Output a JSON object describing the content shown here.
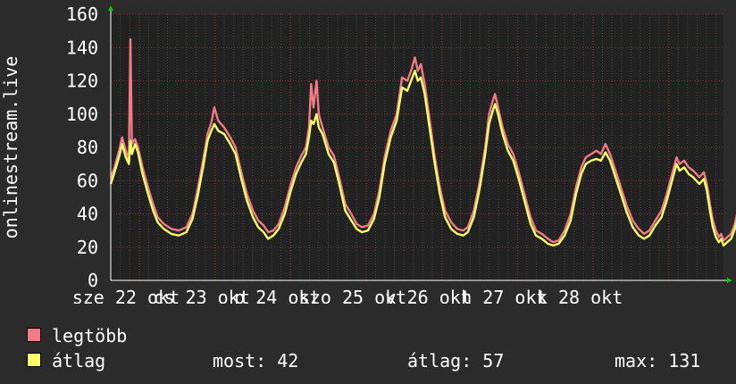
{
  "chart_data": {
    "type": "line",
    "ylabel": "onlinestream.live",
    "ylim": [
      0,
      160
    ],
    "yticks": [
      0,
      20,
      40,
      60,
      80,
      100,
      120,
      140,
      160
    ],
    "xlim": [
      0,
      8.1
    ],
    "grid": true,
    "colors": {
      "background": "#2b2b2b",
      "plot_background": "#222222",
      "grid": "#4a4a4a",
      "max_series": "#f07a85",
      "avg_series": "#ffff66",
      "axis": "#ffffff",
      "arrow": "#00cc00"
    },
    "x_tick_labels": [
      {
        "x": 0.2,
        "label": "sze 22 okt"
      },
      {
        "x": 1.2,
        "label": "cs 23 okt"
      },
      {
        "x": 2.2,
        "label": "p 24 okt"
      },
      {
        "x": 3.2,
        "label": "szo 25 okt"
      },
      {
        "x": 4.2,
        "label": "v 26 okt"
      },
      {
        "x": 5.2,
        "label": "h 27 okt"
      },
      {
        "x": 6.2,
        "label": "k 28 okt"
      }
    ],
    "x_major": [
      0.38,
      1.38,
      2.38,
      3.38,
      4.38,
      5.38,
      6.38,
      7.38
    ],
    "series": [
      {
        "name": "legtöbb",
        "color": "#f07a85",
        "points": [
          [
            0,
            62
          ],
          [
            0.05,
            68
          ],
          [
            0.12,
            80
          ],
          [
            0.15,
            86
          ],
          [
            0.2,
            78
          ],
          [
            0.24,
            73
          ],
          [
            0.26,
            145
          ],
          [
            0.28,
            82
          ],
          [
            0.32,
            85
          ],
          [
            0.36,
            80
          ],
          [
            0.42,
            68
          ],
          [
            0.5,
            55
          ],
          [
            0.56,
            46
          ],
          [
            0.62,
            38
          ],
          [
            0.7,
            34
          ],
          [
            0.8,
            31
          ],
          [
            0.9,
            30
          ],
          [
            1.0,
            32
          ],
          [
            1.08,
            40
          ],
          [
            1.15,
            55
          ],
          [
            1.22,
            72
          ],
          [
            1.28,
            88
          ],
          [
            1.33,
            95
          ],
          [
            1.37,
            104
          ],
          [
            1.42,
            96
          ],
          [
            1.5,
            92
          ],
          [
            1.58,
            86
          ],
          [
            1.65,
            80
          ],
          [
            1.72,
            66
          ],
          [
            1.8,
            52
          ],
          [
            1.88,
            42
          ],
          [
            1.95,
            36
          ],
          [
            2.02,
            33
          ],
          [
            2.08,
            29
          ],
          [
            2.15,
            30
          ],
          [
            2.22,
            34
          ],
          [
            2.3,
            44
          ],
          [
            2.38,
            58
          ],
          [
            2.45,
            68
          ],
          [
            2.52,
            75
          ],
          [
            2.58,
            80
          ],
          [
            2.62,
            92
          ],
          [
            2.65,
            118
          ],
          [
            2.68,
            104
          ],
          [
            2.72,
            120
          ],
          [
            2.75,
            100
          ],
          [
            2.8,
            92
          ],
          [
            2.88,
            80
          ],
          [
            2.95,
            75
          ],
          [
            3.02,
            62
          ],
          [
            3.1,
            46
          ],
          [
            3.18,
            40
          ],
          [
            3.25,
            34
          ],
          [
            3.32,
            32
          ],
          [
            3.4,
            33
          ],
          [
            3.48,
            40
          ],
          [
            3.55,
            54
          ],
          [
            3.62,
            74
          ],
          [
            3.7,
            90
          ],
          [
            3.78,
            100
          ],
          [
            3.85,
            122
          ],
          [
            3.92,
            120
          ],
          [
            3.97,
            126
          ],
          [
            4.02,
            134
          ],
          [
            4.06,
            126
          ],
          [
            4.1,
            130
          ],
          [
            4.15,
            118
          ],
          [
            4.22,
            95
          ],
          [
            4.28,
            75
          ],
          [
            4.35,
            56
          ],
          [
            4.42,
            42
          ],
          [
            4.5,
            35
          ],
          [
            4.58,
            31
          ],
          [
            4.66,
            30
          ],
          [
            4.72,
            32
          ],
          [
            4.8,
            42
          ],
          [
            4.88,
            60
          ],
          [
            4.95,
            80
          ],
          [
            5.0,
            100
          ],
          [
            5.05,
            108
          ],
          [
            5.08,
            112
          ],
          [
            5.12,
            104
          ],
          [
            5.18,
            92
          ],
          [
            5.25,
            82
          ],
          [
            5.32,
            76
          ],
          [
            5.4,
            64
          ],
          [
            5.48,
            50
          ],
          [
            5.55,
            38
          ],
          [
            5.62,
            30
          ],
          [
            5.7,
            28
          ],
          [
            5.78,
            25
          ],
          [
            5.85,
            23
          ],
          [
            5.92,
            24
          ],
          [
            6.0,
            30
          ],
          [
            6.08,
            40
          ],
          [
            6.15,
            56
          ],
          [
            6.22,
            68
          ],
          [
            6.28,
            74
          ],
          [
            6.35,
            76
          ],
          [
            6.42,
            78
          ],
          [
            6.48,
            76
          ],
          [
            6.54,
            82
          ],
          [
            6.6,
            76
          ],
          [
            6.68,
            65
          ],
          [
            6.75,
            55
          ],
          [
            6.82,
            45
          ],
          [
            6.9,
            36
          ],
          [
            6.98,
            31
          ],
          [
            7.05,
            28
          ],
          [
            7.12,
            30
          ],
          [
            7.2,
            36
          ],
          [
            7.28,
            42
          ],
          [
            7.35,
            52
          ],
          [
            7.42,
            64
          ],
          [
            7.48,
            74
          ],
          [
            7.52,
            70
          ],
          [
            7.58,
            72
          ],
          [
            7.64,
            68
          ],
          [
            7.7,
            66
          ],
          [
            7.78,
            62
          ],
          [
            7.84,
            65
          ],
          [
            7.88,
            58
          ],
          [
            7.92,
            46
          ],
          [
            7.96,
            36
          ],
          [
            8.0,
            30
          ],
          [
            8.04,
            26
          ],
          [
            8.07,
            28
          ],
          [
            8.1,
            24
          ],
          [
            8.15,
            26
          ],
          [
            8.2,
            28
          ],
          [
            8.25,
            34
          ],
          [
            8.3,
            44
          ],
          [
            8.34,
            42
          ]
        ]
      },
      {
        "name": "átlag",
        "color": "#ffff66",
        "points": [
          [
            0,
            58
          ],
          [
            0.05,
            65
          ],
          [
            0.12,
            76
          ],
          [
            0.15,
            82
          ],
          [
            0.2,
            74
          ],
          [
            0.24,
            70
          ],
          [
            0.26,
            84
          ],
          [
            0.28,
            76
          ],
          [
            0.32,
            82
          ],
          [
            0.36,
            77
          ],
          [
            0.42,
            64
          ],
          [
            0.5,
            51
          ],
          [
            0.56,
            42
          ],
          [
            0.62,
            35
          ],
          [
            0.7,
            31
          ],
          [
            0.8,
            28
          ],
          [
            0.9,
            27
          ],
          [
            1.0,
            29
          ],
          [
            1.08,
            37
          ],
          [
            1.15,
            51
          ],
          [
            1.22,
            68
          ],
          [
            1.28,
            84
          ],
          [
            1.33,
            90
          ],
          [
            1.37,
            94
          ],
          [
            1.42,
            90
          ],
          [
            1.5,
            88
          ],
          [
            1.58,
            82
          ],
          [
            1.65,
            76
          ],
          [
            1.72,
            62
          ],
          [
            1.8,
            48
          ],
          [
            1.88,
            38
          ],
          [
            1.95,
            32
          ],
          [
            2.02,
            29
          ],
          [
            2.08,
            25
          ],
          [
            2.15,
            27
          ],
          [
            2.22,
            31
          ],
          [
            2.3,
            40
          ],
          [
            2.38,
            54
          ],
          [
            2.45,
            64
          ],
          [
            2.52,
            71
          ],
          [
            2.58,
            76
          ],
          [
            2.62,
            86
          ],
          [
            2.65,
            96
          ],
          [
            2.68,
            94
          ],
          [
            2.72,
            100
          ],
          [
            2.75,
            92
          ],
          [
            2.8,
            88
          ],
          [
            2.88,
            76
          ],
          [
            2.95,
            71
          ],
          [
            3.02,
            58
          ],
          [
            3.1,
            42
          ],
          [
            3.18,
            36
          ],
          [
            3.25,
            31
          ],
          [
            3.32,
            29
          ],
          [
            3.4,
            30
          ],
          [
            3.48,
            37
          ],
          [
            3.55,
            50
          ],
          [
            3.62,
            70
          ],
          [
            3.7,
            86
          ],
          [
            3.78,
            96
          ],
          [
            3.85,
            116
          ],
          [
            3.92,
            114
          ],
          [
            3.97,
            120
          ],
          [
            4.02,
            126
          ],
          [
            4.06,
            120
          ],
          [
            4.1,
            122
          ],
          [
            4.15,
            112
          ],
          [
            4.22,
            90
          ],
          [
            4.28,
            71
          ],
          [
            4.35,
            52
          ],
          [
            4.42,
            38
          ],
          [
            4.5,
            31
          ],
          [
            4.58,
            28
          ],
          [
            4.66,
            27
          ],
          [
            4.72,
            29
          ],
          [
            4.8,
            38
          ],
          [
            4.88,
            56
          ],
          [
            4.95,
            76
          ],
          [
            5.0,
            94
          ],
          [
            5.05,
            102
          ],
          [
            5.08,
            106
          ],
          [
            5.12,
            100
          ],
          [
            5.18,
            88
          ],
          [
            5.25,
            78
          ],
          [
            5.32,
            72
          ],
          [
            5.4,
            60
          ],
          [
            5.48,
            46
          ],
          [
            5.55,
            34
          ],
          [
            5.62,
            27
          ],
          [
            5.7,
            25
          ],
          [
            5.78,
            22
          ],
          [
            5.85,
            21
          ],
          [
            5.92,
            22
          ],
          [
            6.0,
            27
          ],
          [
            6.08,
            36
          ],
          [
            6.15,
            52
          ],
          [
            6.22,
            64
          ],
          [
            6.28,
            70
          ],
          [
            6.35,
            72
          ],
          [
            6.42,
            73
          ],
          [
            6.48,
            72
          ],
          [
            6.54,
            77
          ],
          [
            6.6,
            72
          ],
          [
            6.68,
            61
          ],
          [
            6.75,
            51
          ],
          [
            6.82,
            41
          ],
          [
            6.9,
            32
          ],
          [
            6.98,
            27
          ],
          [
            7.05,
            25
          ],
          [
            7.12,
            27
          ],
          [
            7.2,
            33
          ],
          [
            7.28,
            38
          ],
          [
            7.35,
            48
          ],
          [
            7.42,
            60
          ],
          [
            7.48,
            70
          ],
          [
            7.52,
            66
          ],
          [
            7.58,
            68
          ],
          [
            7.64,
            64
          ],
          [
            7.7,
            62
          ],
          [
            7.78,
            58
          ],
          [
            7.84,
            61
          ],
          [
            7.88,
            54
          ],
          [
            7.92,
            42
          ],
          [
            7.96,
            32
          ],
          [
            8.0,
            26
          ],
          [
            8.04,
            23
          ],
          [
            8.07,
            25
          ],
          [
            8.1,
            21
          ],
          [
            8.15,
            23
          ],
          [
            8.2,
            25
          ],
          [
            8.25,
            31
          ],
          [
            8.3,
            40
          ],
          [
            8.34,
            42
          ]
        ]
      }
    ],
    "legend": {
      "items": [
        {
          "label": "legtöbb",
          "color": "#f07a85"
        },
        {
          "label": "átlag",
          "color": "#ffff66"
        }
      ],
      "stats": {
        "most": "most: 42",
        "atlag": "átlag: 57",
        "max": "max: 131"
      }
    }
  }
}
